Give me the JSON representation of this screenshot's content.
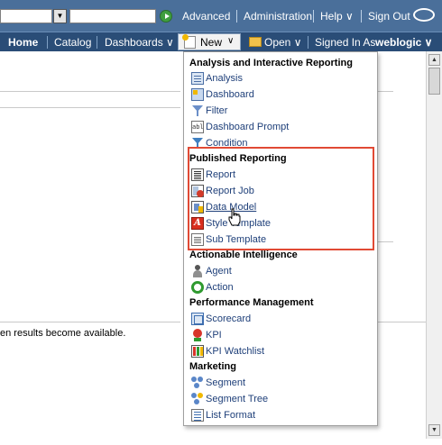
{
  "header": {
    "links": {
      "advanced": "Advanced",
      "administration": "Administration",
      "help": "Help ∨",
      "sign_out": "Sign Out"
    }
  },
  "nav": {
    "home": "Home",
    "catalog": "Catalog",
    "dashboards": "Dashboards ∨",
    "new": "New",
    "open": "Open ∨",
    "signed_in_as": "Signed In As",
    "user": "weblogic ∨"
  },
  "content": {
    "visible_text": "en results become available."
  },
  "new_menu": {
    "sections": {
      "analysis": {
        "title": "Analysis and Interactive Reporting",
        "items": [
          "Analysis",
          "Dashboard",
          "Filter",
          "Dashboard Prompt",
          "Condition"
        ]
      },
      "published": {
        "title": "Published Reporting",
        "items": [
          "Report",
          "Report Job",
          "Data Model",
          "Style Template",
          "Sub Template"
        ]
      },
      "actionable": {
        "title": "Actionable Intelligence",
        "items": [
          "Agent",
          "Action"
        ]
      },
      "performance": {
        "title": "Performance Management",
        "items": [
          "Scorecard",
          "KPI",
          "KPI Watchlist"
        ]
      },
      "marketing": {
        "title": "Marketing",
        "items": [
          "Segment",
          "Segment Tree",
          "List Format"
        ]
      }
    },
    "prompt_icon_text": "abl",
    "style_template_icon_text": "A"
  },
  "colors": {
    "topbar": "#4a6f9a",
    "navbar": "#2a4d77",
    "menu_link": "#1e3f79",
    "highlight": "#e14a35"
  }
}
